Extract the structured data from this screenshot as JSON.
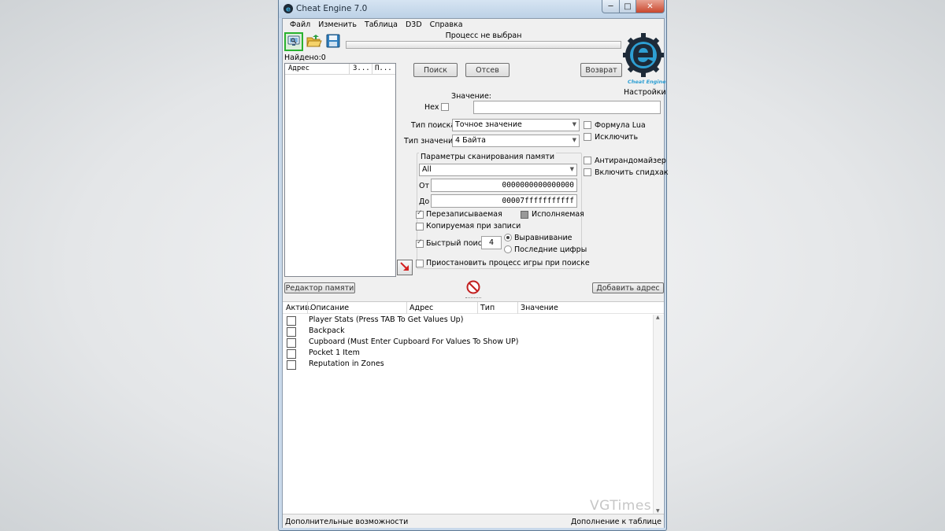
{
  "window": {
    "title": "Cheat Engine 7.0",
    "minimize": "─",
    "maximize": "□",
    "close": "✕"
  },
  "menu": [
    "Файл",
    "Изменить",
    "Таблица",
    "D3D",
    "Справка"
  ],
  "toolbar": {
    "open_process_icon": "monitor-icon",
    "open_file_icon": "folder-open-icon",
    "save_icon": "floppy-disk-icon"
  },
  "process_label": "Процесс не выбран",
  "found_label": "Найдено:0",
  "results_columns": [
    "Адрес",
    "З...",
    "П..."
  ],
  "scan_buttons": {
    "first_scan": "Поиск",
    "next_scan": "Отсев",
    "undo_scan": "Возврат"
  },
  "settings_label": "Настройки",
  "logo_caption": "Cheat Engine",
  "value_label": "Значение:",
  "hex_label": "Hex",
  "scan_type": {
    "label": "Тип поиска",
    "value": "Точное значение"
  },
  "value_type": {
    "label": "Тип значения",
    "value": "4 Байта"
  },
  "right_options": {
    "lua_formula": "Формула Lua",
    "exclude": "Исключить",
    "antirandomizer": "Антирандомайзер",
    "speedhack": "Включить спидхак"
  },
  "memory_scan": {
    "title": "Параметры сканирования памяти",
    "region": "All",
    "from_label": "От",
    "from_value": "0000000000000000",
    "to_label": "До",
    "to_value": "00007fffffffffff",
    "writable": "Перезаписываемая",
    "executable": "Исполняемая",
    "copy_on_write": "Копируемая при записи",
    "fast_scan": "Быстрый поиск",
    "fast_scan_value": "4",
    "alignment": "Выравнивание",
    "last_digits": "Последние цифры",
    "pause_process": "Приостановить процесс игры при поиске"
  },
  "memory_view_button": "Редактор памяти",
  "add_address_button": "Добавить адрес",
  "address_table": {
    "columns": [
      "Актив.",
      "Описание",
      "Адрес",
      "Тип",
      "Значение"
    ],
    "rows": [
      "Player Stats (Press TAB To Get Values Up)",
      "Backpack",
      "Cupboard  (Must Enter Cupboard For Values To Show UP)",
      "Pocket 1 Item",
      "Reputation in Zones"
    ]
  },
  "watermark": "VGTimes",
  "status": {
    "left": "Дополнительные возможности",
    "right": "Дополнение к таблице"
  }
}
